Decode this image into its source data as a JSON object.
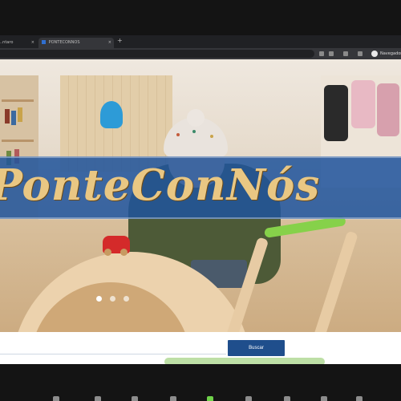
{
  "browser": {
    "tabs": [
      {
        "label": "..ntaro",
        "active": false
      },
      {
        "label": "PONTECONNOS",
        "active": true
      }
    ],
    "new_tab_icon": "plus-icon",
    "profile_label": "Navegador"
  },
  "site": {
    "banner_title": "PonteConNós",
    "carousel": {
      "slides": 3,
      "active_index": 0
    },
    "search": {
      "placeholder": "",
      "button_label": "Buscar"
    }
  },
  "colors": {
    "banner_blue": "#1f549c",
    "title_gold": "#e9c783",
    "button_blue": "#1f4e8c"
  }
}
